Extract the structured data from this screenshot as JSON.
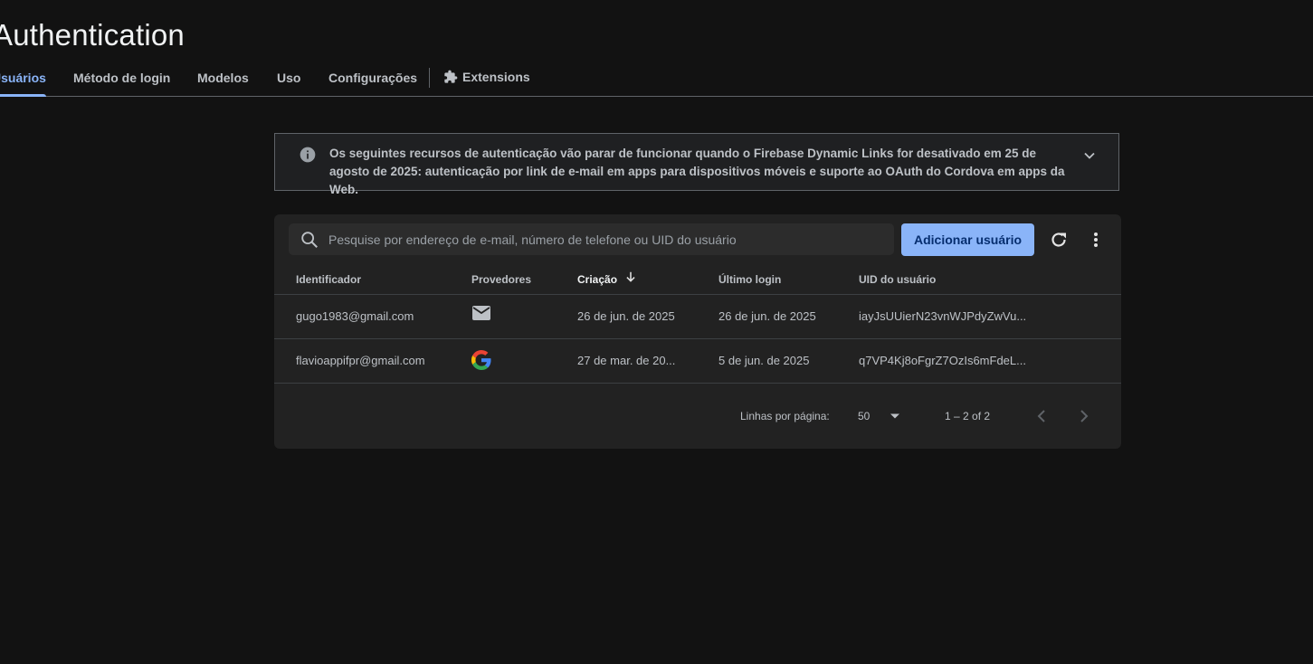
{
  "page": {
    "title": "Authentication"
  },
  "tabs": [
    {
      "label": "Usuários",
      "active": true
    },
    {
      "label": "Método de login"
    },
    {
      "label": "Modelos"
    },
    {
      "label": "Uso"
    },
    {
      "label": "Configurações"
    },
    {
      "label": "Extensions",
      "icon": "puzzle-icon"
    }
  ],
  "banner": {
    "icon": "info-icon",
    "text": "Os seguintes recursos de autenticação vão parar de funcionar quando o Firebase Dynamic Links for desativado em 25 de agosto de 2025: autenticação por link de e-mail em apps para dispositivos móveis e suporte ao OAuth do Cordova em apps da Web.",
    "expand_icon": "chevron-down-icon"
  },
  "toolbar": {
    "search_placeholder": "Pesquise por endereço de e-mail, número de telefone ou UID do usuário",
    "search_value": "",
    "add_user_label": "Adicionar usuário"
  },
  "table": {
    "columns": [
      "Identificador",
      "Provedores",
      "Criação",
      "Último login",
      "UID do usuário"
    ],
    "sorted_column": "Criação",
    "rows": [
      {
        "identifier": "gugo1983@gmail.com",
        "provider": "email-icon",
        "created": "26 de jun. de 2025",
        "last_login": "26 de jun. de 2025",
        "uid": "iayJsUUierN23vnWJPdyZwVu..."
      },
      {
        "identifier": "flavioappifpr@gmail.com",
        "provider": "google-icon",
        "created": "27 de mar. de 20...",
        "last_login": "5 de jun. de 2025",
        "uid": "q7VP4Kj8oFgrZ7OzIs6mFdeL..."
      }
    ]
  },
  "pagination": {
    "rows_per_page_label": "Linhas por página:",
    "rows_per_page_value": "50",
    "range": "1 – 2 of 2"
  },
  "colors": {
    "background": "#121212",
    "card": "#222222",
    "accent": "#8ab4f8",
    "text": "#bdc1c6"
  }
}
